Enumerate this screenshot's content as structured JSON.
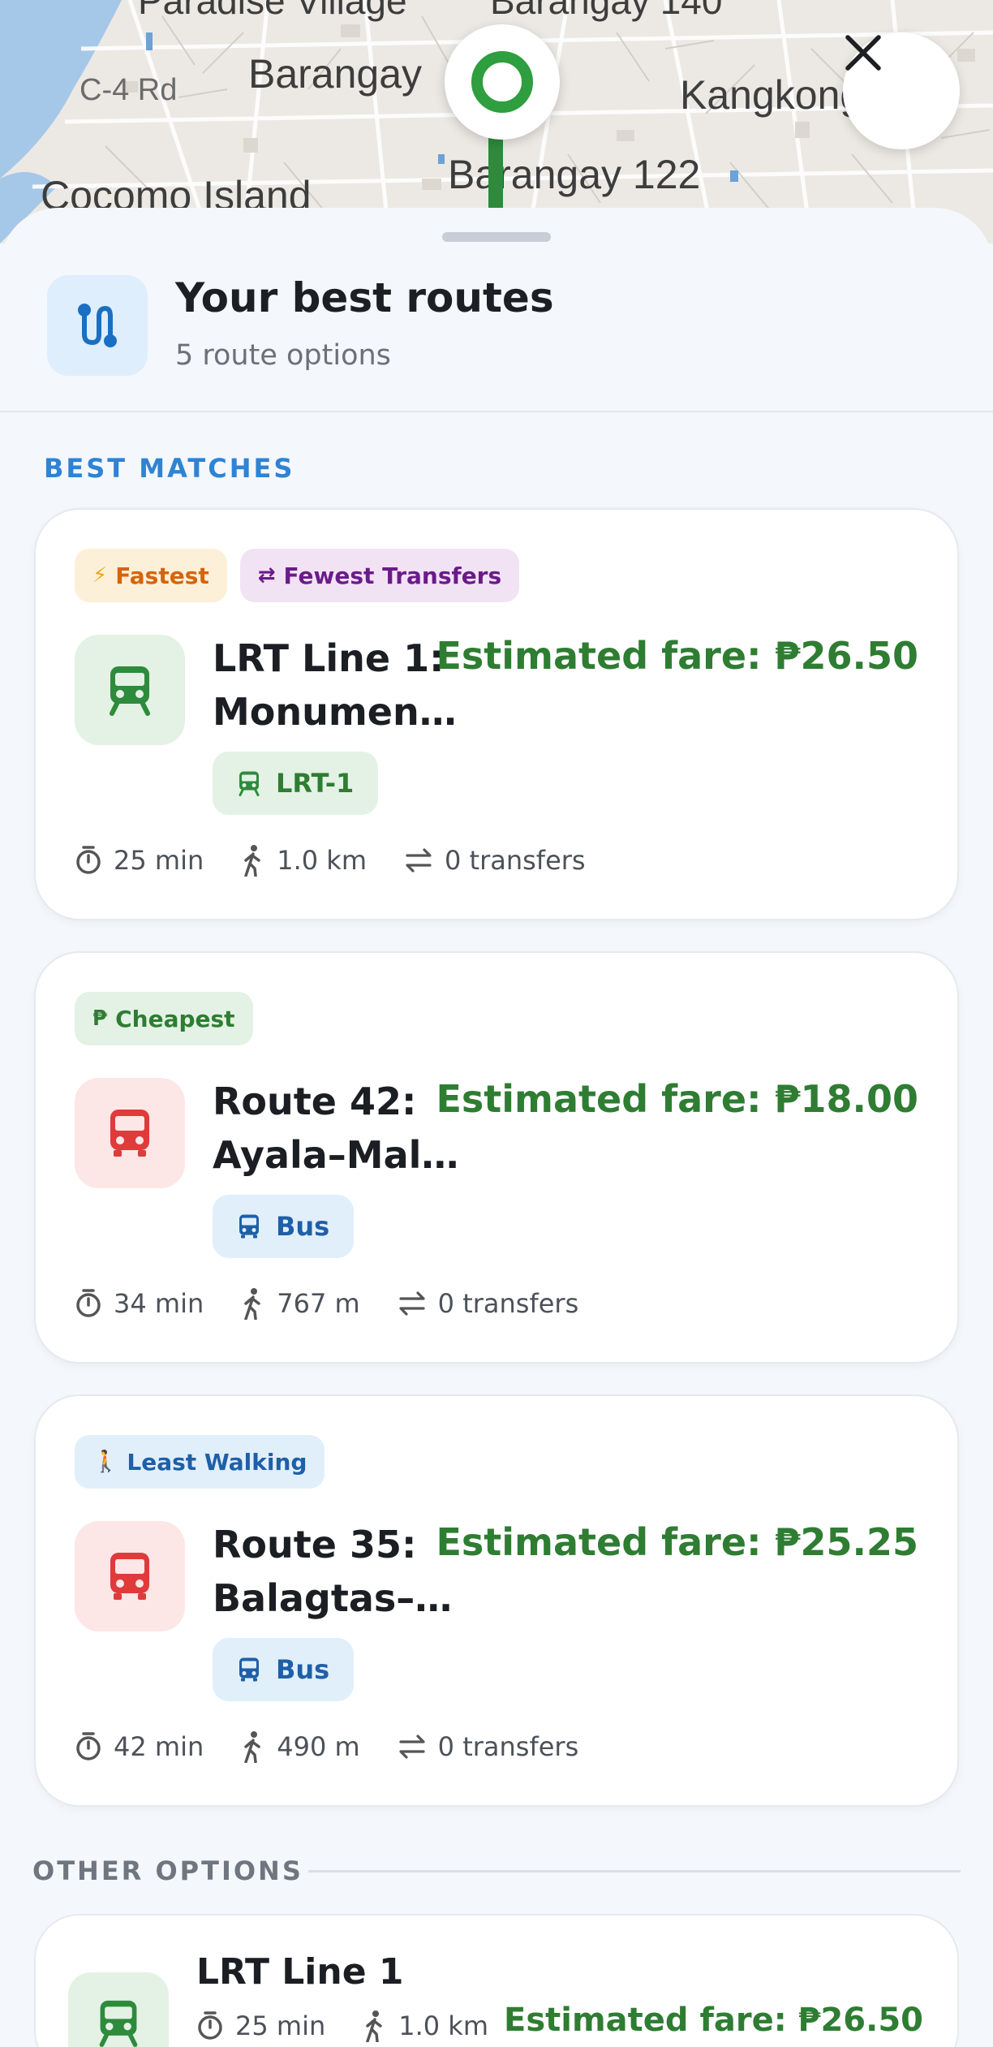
{
  "map": {
    "labels": [
      "Paradise Village",
      "Barangay 140",
      "C-4 Rd",
      "Barangay",
      "Kangkong",
      "Barangay 122",
      "Cocomo Island"
    ]
  },
  "close": {
    "icon": "close-icon"
  },
  "header": {
    "icon": "route-icon",
    "title": "Your best routes",
    "subtitle": "5 route options"
  },
  "best_matches": {
    "label": "BEST MATCHES",
    "cards": [
      {
        "badges": [
          {
            "icon": "⚡",
            "label": "Fastest"
          },
          {
            "icon": "⇄",
            "label": "Fewest Transfers"
          }
        ],
        "mode_icon": "train-icon",
        "name_line1": "LRT Line 1:",
        "name_line2": "Monumento…",
        "fare": "Estimated fare: ₱26.50",
        "chip": "LRT-1",
        "duration": "25 min",
        "walk": "1.0 km",
        "transfers": "0 transfers"
      },
      {
        "badges": [
          {
            "icon": "₱",
            "label": "Cheapest"
          }
        ],
        "mode_icon": "bus-icon",
        "name_line1": "Route 42:",
        "name_line2": "Ayala–Mala…",
        "fare": "Estimated fare: ₱18.00",
        "chip": "Bus",
        "duration": "34 min",
        "walk": "767 m",
        "transfers": "0 transfers"
      },
      {
        "badges": [
          {
            "icon": "🚶",
            "label": "Least Walking"
          }
        ],
        "mode_icon": "bus-icon",
        "name_line1": "Route 35:",
        "name_line2": "Balagtas–N…",
        "fare": "Estimated fare: ₱25.25",
        "chip": "Bus",
        "duration": "42 min",
        "walk": "490 m",
        "transfers": "0 transfers"
      }
    ]
  },
  "other_options": {
    "label": "OTHER OPTIONS",
    "cards": [
      {
        "mode_icon": "train-icon",
        "name": "LRT Line 1",
        "duration": "25 min",
        "walk": "1.0 km",
        "fare": "Estimated fare: ₱26.50"
      }
    ]
  },
  "colors": {
    "accent_blue": "#2f83d4",
    "fare_green": "#2e7d32",
    "fastest_bg": "#fdf0d8",
    "fastest_fg": "#d5640f",
    "transfers_bg": "#f2e3f4",
    "transfers_fg": "#6a1b8a",
    "cheapest_bg": "#e4f2e6",
    "cheapest_fg": "#2e7d32",
    "walking_bg": "#e1effb",
    "walking_fg": "#1f5fa8"
  }
}
